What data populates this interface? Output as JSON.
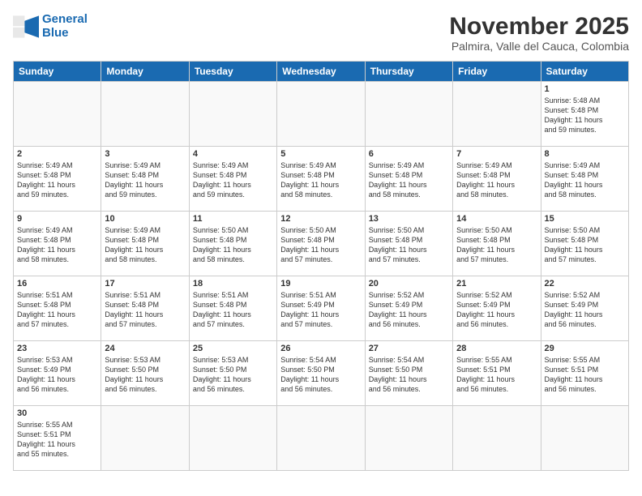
{
  "header": {
    "logo_line1": "General",
    "logo_line2": "Blue",
    "month_title": "November 2025",
    "subtitle": "Palmira, Valle del Cauca, Colombia"
  },
  "days_of_week": [
    "Sunday",
    "Monday",
    "Tuesday",
    "Wednesday",
    "Thursday",
    "Friday",
    "Saturday"
  ],
  "weeks": [
    [
      {
        "day": "",
        "info": ""
      },
      {
        "day": "",
        "info": ""
      },
      {
        "day": "",
        "info": ""
      },
      {
        "day": "",
        "info": ""
      },
      {
        "day": "",
        "info": ""
      },
      {
        "day": "",
        "info": ""
      },
      {
        "day": "1",
        "info": "Sunrise: 5:48 AM\nSunset: 5:48 PM\nDaylight: 11 hours\nand 59 minutes."
      }
    ],
    [
      {
        "day": "2",
        "info": "Sunrise: 5:49 AM\nSunset: 5:48 PM\nDaylight: 11 hours\nand 59 minutes."
      },
      {
        "day": "3",
        "info": "Sunrise: 5:49 AM\nSunset: 5:48 PM\nDaylight: 11 hours\nand 59 minutes."
      },
      {
        "day": "4",
        "info": "Sunrise: 5:49 AM\nSunset: 5:48 PM\nDaylight: 11 hours\nand 59 minutes."
      },
      {
        "day": "5",
        "info": "Sunrise: 5:49 AM\nSunset: 5:48 PM\nDaylight: 11 hours\nand 58 minutes."
      },
      {
        "day": "6",
        "info": "Sunrise: 5:49 AM\nSunset: 5:48 PM\nDaylight: 11 hours\nand 58 minutes."
      },
      {
        "day": "7",
        "info": "Sunrise: 5:49 AM\nSunset: 5:48 PM\nDaylight: 11 hours\nand 58 minutes."
      },
      {
        "day": "8",
        "info": "Sunrise: 5:49 AM\nSunset: 5:48 PM\nDaylight: 11 hours\nand 58 minutes."
      }
    ],
    [
      {
        "day": "9",
        "info": "Sunrise: 5:49 AM\nSunset: 5:48 PM\nDaylight: 11 hours\nand 58 minutes."
      },
      {
        "day": "10",
        "info": "Sunrise: 5:49 AM\nSunset: 5:48 PM\nDaylight: 11 hours\nand 58 minutes."
      },
      {
        "day": "11",
        "info": "Sunrise: 5:50 AM\nSunset: 5:48 PM\nDaylight: 11 hours\nand 58 minutes."
      },
      {
        "day": "12",
        "info": "Sunrise: 5:50 AM\nSunset: 5:48 PM\nDaylight: 11 hours\nand 57 minutes."
      },
      {
        "day": "13",
        "info": "Sunrise: 5:50 AM\nSunset: 5:48 PM\nDaylight: 11 hours\nand 57 minutes."
      },
      {
        "day": "14",
        "info": "Sunrise: 5:50 AM\nSunset: 5:48 PM\nDaylight: 11 hours\nand 57 minutes."
      },
      {
        "day": "15",
        "info": "Sunrise: 5:50 AM\nSunset: 5:48 PM\nDaylight: 11 hours\nand 57 minutes."
      }
    ],
    [
      {
        "day": "16",
        "info": "Sunrise: 5:51 AM\nSunset: 5:48 PM\nDaylight: 11 hours\nand 57 minutes."
      },
      {
        "day": "17",
        "info": "Sunrise: 5:51 AM\nSunset: 5:48 PM\nDaylight: 11 hours\nand 57 minutes."
      },
      {
        "day": "18",
        "info": "Sunrise: 5:51 AM\nSunset: 5:48 PM\nDaylight: 11 hours\nand 57 minutes."
      },
      {
        "day": "19",
        "info": "Sunrise: 5:51 AM\nSunset: 5:49 PM\nDaylight: 11 hours\nand 57 minutes."
      },
      {
        "day": "20",
        "info": "Sunrise: 5:52 AM\nSunset: 5:49 PM\nDaylight: 11 hours\nand 56 minutes."
      },
      {
        "day": "21",
        "info": "Sunrise: 5:52 AM\nSunset: 5:49 PM\nDaylight: 11 hours\nand 56 minutes."
      },
      {
        "day": "22",
        "info": "Sunrise: 5:52 AM\nSunset: 5:49 PM\nDaylight: 11 hours\nand 56 minutes."
      }
    ],
    [
      {
        "day": "23",
        "info": "Sunrise: 5:53 AM\nSunset: 5:49 PM\nDaylight: 11 hours\nand 56 minutes."
      },
      {
        "day": "24",
        "info": "Sunrise: 5:53 AM\nSunset: 5:50 PM\nDaylight: 11 hours\nand 56 minutes."
      },
      {
        "day": "25",
        "info": "Sunrise: 5:53 AM\nSunset: 5:50 PM\nDaylight: 11 hours\nand 56 minutes."
      },
      {
        "day": "26",
        "info": "Sunrise: 5:54 AM\nSunset: 5:50 PM\nDaylight: 11 hours\nand 56 minutes."
      },
      {
        "day": "27",
        "info": "Sunrise: 5:54 AM\nSunset: 5:50 PM\nDaylight: 11 hours\nand 56 minutes."
      },
      {
        "day": "28",
        "info": "Sunrise: 5:55 AM\nSunset: 5:51 PM\nDaylight: 11 hours\nand 56 minutes."
      },
      {
        "day": "29",
        "info": "Sunrise: 5:55 AM\nSunset: 5:51 PM\nDaylight: 11 hours\nand 56 minutes."
      }
    ],
    [
      {
        "day": "30",
        "info": "Sunrise: 5:55 AM\nSunset: 5:51 PM\nDaylight: 11 hours\nand 55 minutes."
      },
      {
        "day": "",
        "info": ""
      },
      {
        "day": "",
        "info": ""
      },
      {
        "day": "",
        "info": ""
      },
      {
        "day": "",
        "info": ""
      },
      {
        "day": "",
        "info": ""
      },
      {
        "day": "",
        "info": ""
      }
    ]
  ]
}
